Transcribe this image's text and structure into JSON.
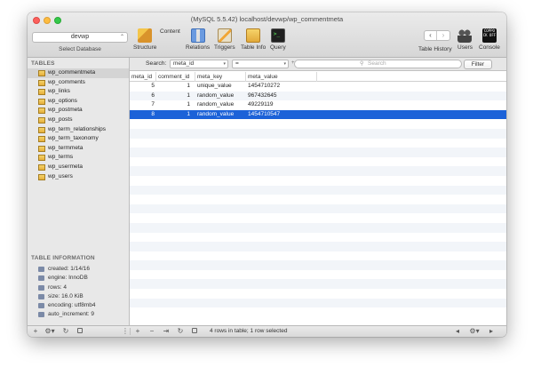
{
  "window": {
    "title": "(MySQL 5.5.42) localhost/devwp/wp_commentmeta"
  },
  "database": {
    "selected": "devwp",
    "caption": "Select Database"
  },
  "toolbar": {
    "tools": [
      {
        "label": "Structure",
        "icon": "structure-icon"
      },
      {
        "label": "Content",
        "icon": "content-icon"
      },
      {
        "label": "Relations",
        "icon": "relations-icon"
      },
      {
        "label": "Triggers",
        "icon": "triggers-icon"
      },
      {
        "label": "Table Info",
        "icon": "table-info-icon"
      },
      {
        "label": "Query",
        "icon": "query-icon"
      }
    ],
    "right_tools": [
      {
        "label": "Table History",
        "icon": "history-nav-icon"
      },
      {
        "label": "Users",
        "icon": "users-icon"
      },
      {
        "label": "Console",
        "icon": "console-icon"
      }
    ],
    "console_icon_text": "COPPO\nCK OFF"
  },
  "sidebar": {
    "tables_header": "TABLES",
    "tables": [
      "wp_commentmeta",
      "wp_comments",
      "wp_links",
      "wp_options",
      "wp_postmeta",
      "wp_posts",
      "wp_term_relationships",
      "wp_term_taxonomy",
      "wp_termmeta",
      "wp_terms",
      "wp_usermeta",
      "wp_users"
    ],
    "selected_table": "wp_commentmeta",
    "info_header": "TABLE INFORMATION",
    "info": [
      "created: 1/14/16",
      "engine: InnoDB",
      "rows: 4",
      "size: 16.0 KiB",
      "encoding: utf8mb4",
      "auto_increment: 9"
    ]
  },
  "search": {
    "label": "Search:",
    "field": "meta_id",
    "operator": "=",
    "placeholder": "Search",
    "filter_button": "Filter"
  },
  "grid": {
    "columns": [
      "meta_id",
      "comment_id",
      "meta_key",
      "meta_value"
    ],
    "rows": [
      {
        "meta_id": "5",
        "comment_id": "1",
        "meta_key": "unique_value",
        "meta_value": "1454710272"
      },
      {
        "meta_id": "6",
        "comment_id": "1",
        "meta_key": "random_value",
        "meta_value": "967432645"
      },
      {
        "meta_id": "7",
        "comment_id": "1",
        "meta_key": "random_value",
        "meta_value": "49229119"
      },
      {
        "meta_id": "8",
        "comment_id": "1",
        "meta_key": "random_value",
        "meta_value": "1454710547"
      }
    ],
    "selected_row_index": 3
  },
  "status": {
    "text": "4 rows in table; 1 row selected"
  },
  "colors": {
    "selection": "#1c62d8",
    "sidebar_bg": "#e8e8e8",
    "toolbar_bg": "#d6d6d6"
  }
}
